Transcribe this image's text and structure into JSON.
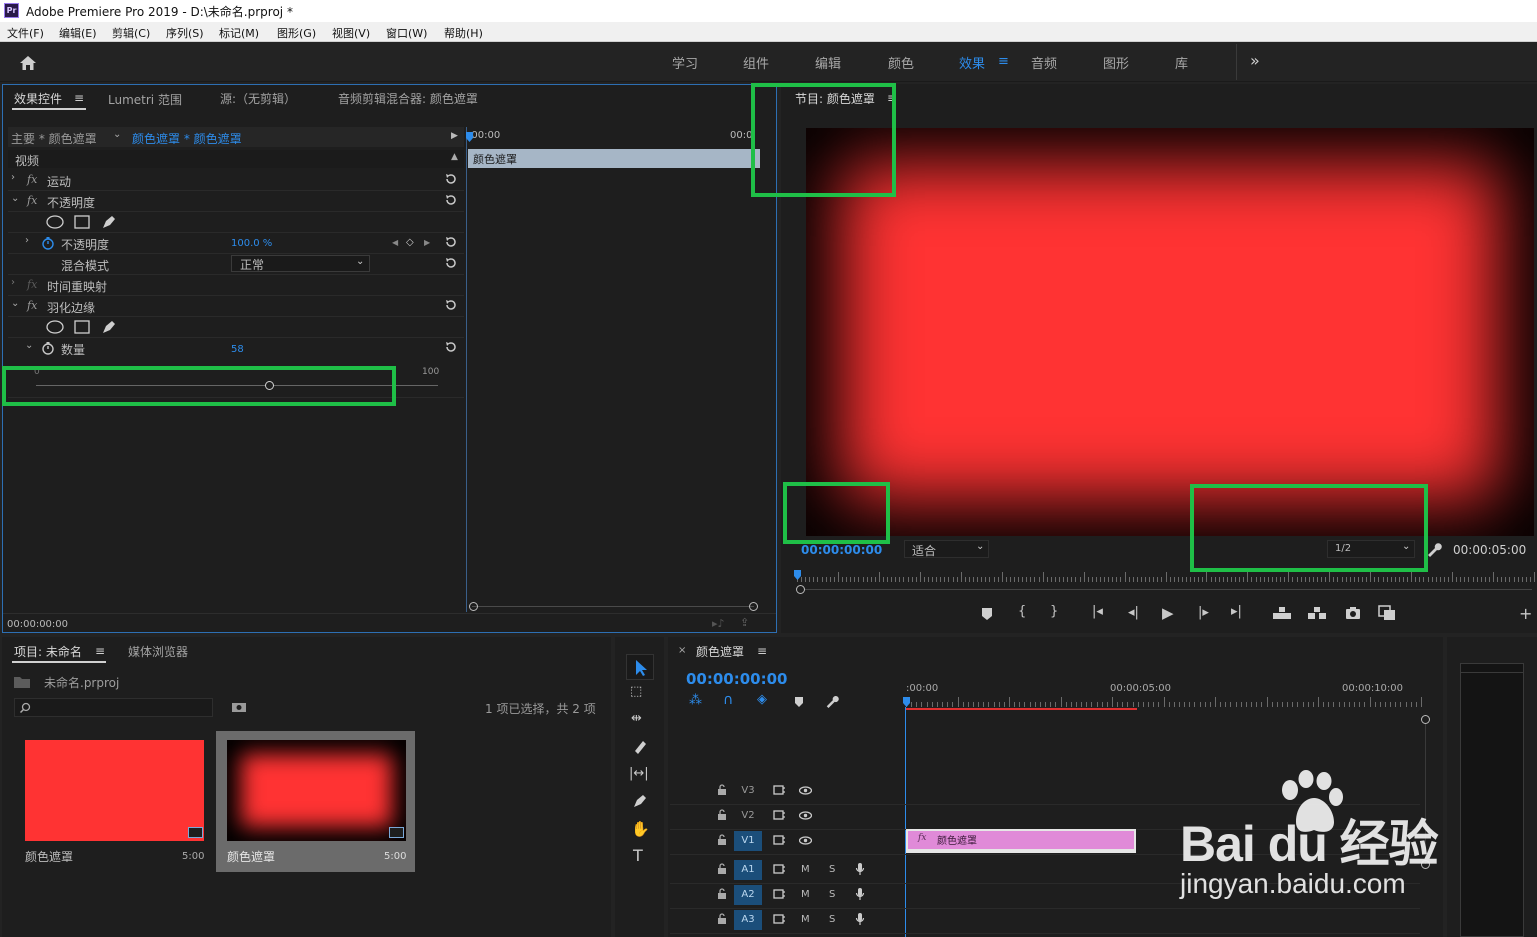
{
  "window": {
    "title": "Adobe Premiere Pro 2019 - D:\\未命名.prproj *",
    "app_icon": "Pr"
  },
  "menu": [
    "文件(F)",
    "编辑(E)",
    "剪辑(C)",
    "序列(S)",
    "标记(M)",
    "图形(G)",
    "视图(V)",
    "窗口(W)",
    "帮助(H)"
  ],
  "workspaces": {
    "tabs": [
      "学习",
      "组件",
      "编辑",
      "颜色",
      "效果",
      "音频",
      "图形",
      "库"
    ],
    "active": "效果",
    "overflow": "»"
  },
  "effect_controls": {
    "tabs": [
      "效果控件",
      "Lumetri 范围",
      "源:（无剪辑）",
      "音频剪辑混合器: 颜色遮罩"
    ],
    "master_label": "主要 * 颜色遮罩",
    "clip_label": "颜色遮罩 * 颜色遮罩",
    "section_video": "视频",
    "motion": "运动",
    "opacity": "不透明度",
    "opacity_param": "不透明度",
    "opacity_value": "100.0 %",
    "blend_mode_label": "混合模式",
    "blend_mode_value": "正常",
    "time_remap": "时间重映射",
    "feather_edges": "羽化边缘",
    "amount_label": "数量",
    "amount_value": "58",
    "slider_min": "0",
    "slider_max": "100",
    "slider_value": 58,
    "timeline_start": ":00:00",
    "timeline_end": "00:0",
    "clip_bar_label": "颜色遮罩",
    "timecode": "00:00:00:00"
  },
  "program": {
    "title": "节目: 颜色遮罩",
    "timecode": "00:00:00:00",
    "fit": "适合",
    "resolution": "1/2",
    "duration": "00:00:05:00",
    "colors": {
      "matte": "#ff3333",
      "edge": "#000000"
    }
  },
  "project": {
    "tabs": [
      "项目: 未命名",
      "媒体浏览器"
    ],
    "file": "未命名.prproj",
    "search_placeholder": "",
    "selection_info": "1 项已选择，共 2 项",
    "items": [
      {
        "name": "颜色遮罩",
        "duration": "5:00",
        "feathered": false
      },
      {
        "name": "颜色遮罩",
        "duration": "5:00",
        "feathered": true
      }
    ]
  },
  "sequence": {
    "title": "颜色遮罩",
    "timecode": "00:00:00:00",
    "ruler": [
      ":00:00",
      "00:00:05:00",
      "00:00:10:00"
    ],
    "video_tracks": [
      "V3",
      "V2",
      "V1"
    ],
    "audio_tracks": [
      "A1",
      "A2",
      "A3"
    ],
    "clip_label": "颜色遮罩",
    "track_mute": "M",
    "track_solo": "S"
  },
  "watermark": {
    "brand": "Bai du 经验",
    "url": "jingyan.baidu.com"
  },
  "accent": "#2d8ceb",
  "highlight": "#1fbf47"
}
